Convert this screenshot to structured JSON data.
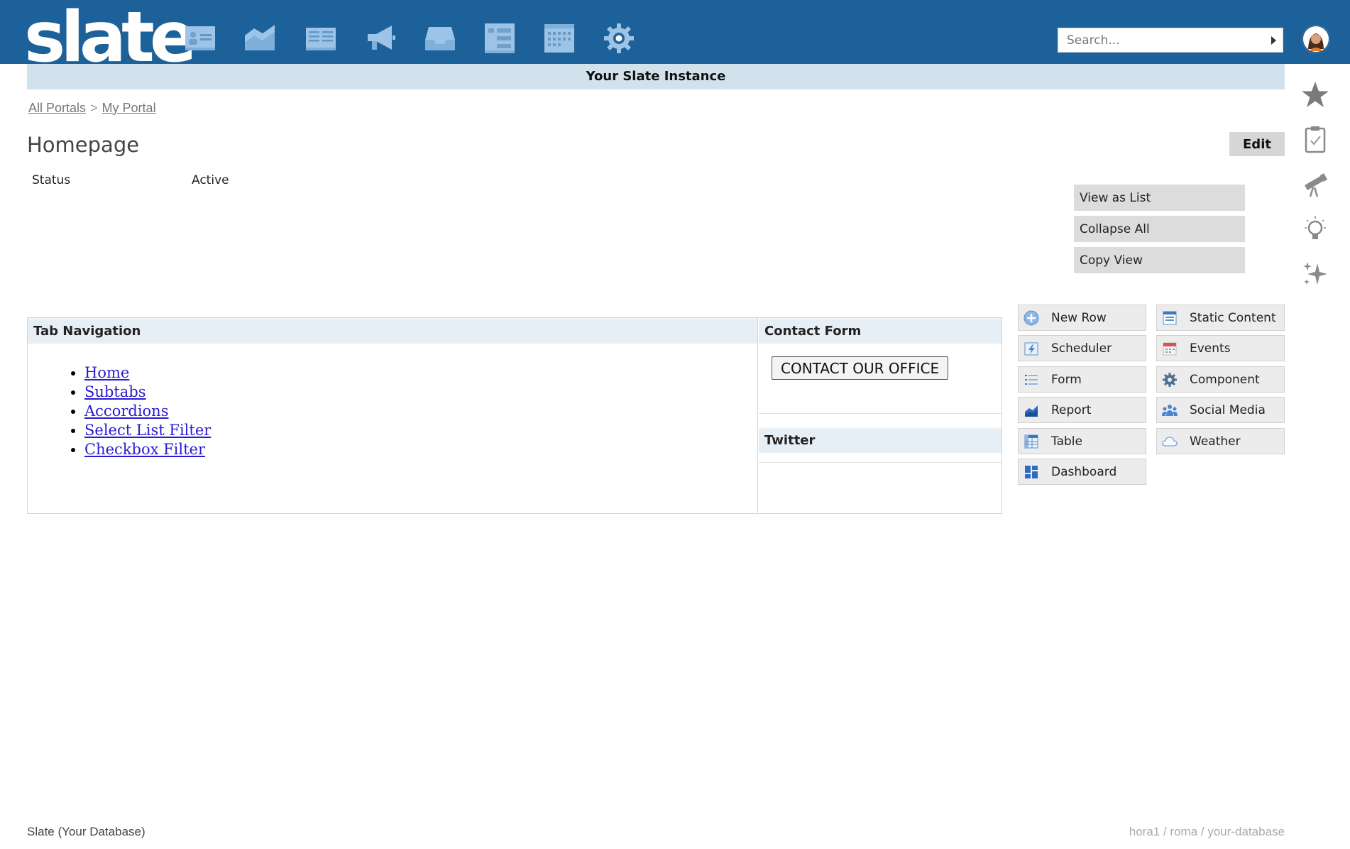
{
  "app": {
    "logo_text": "slate",
    "instance_banner": "Your Slate Instance",
    "brand_color": "#1c6199"
  },
  "nav_icons": [
    "contacts-card-icon",
    "reports-chart-icon",
    "book-icon",
    "megaphone-icon",
    "inbox-tray-icon",
    "list-icon",
    "calendar-icon",
    "gear-icon"
  ],
  "search": {
    "placeholder": "Search..."
  },
  "rail_icons": [
    "star-icon",
    "clipboard-check-icon",
    "telescope-icon",
    "lightbulb-icon",
    "sparkles-icon"
  ],
  "breadcrumb": {
    "items": [
      "All Portals",
      "My Portal"
    ],
    "separator": ">"
  },
  "page": {
    "title": "Homepage",
    "edit_label": "Edit",
    "status_label": "Status",
    "status_value": "Active"
  },
  "view_actions": [
    "View as List",
    "Collapse All",
    "Copy View"
  ],
  "canvas": {
    "tab_nav_title": "Tab Navigation",
    "tab_links": [
      "Home",
      "Subtabs",
      "Accordions",
      "Select List Filter",
      "Checkbox Filter"
    ],
    "contact_form_title": "Contact Form",
    "contact_button_label": "CONTACT OUR OFFICE",
    "twitter_title": "Twitter"
  },
  "widgets": [
    {
      "label": "New Row",
      "icon": "plus-circle-icon"
    },
    {
      "label": "Static Content",
      "icon": "static-content-icon"
    },
    {
      "label": "Scheduler",
      "icon": "scheduler-icon"
    },
    {
      "label": "Events",
      "icon": "events-calendar-icon"
    },
    {
      "label": "Form",
      "icon": "form-list-icon"
    },
    {
      "label": "Component",
      "icon": "component-gear-icon"
    },
    {
      "label": "Report",
      "icon": "report-chart-icon"
    },
    {
      "label": "Social Media",
      "icon": "social-media-icon"
    },
    {
      "label": "Table",
      "icon": "table-icon"
    },
    {
      "label": "Weather",
      "icon": "weather-cloud-icon"
    },
    {
      "label": "Dashboard",
      "icon": "dashboard-icon"
    }
  ],
  "footer": {
    "left": "Slate (Your Database)",
    "right": "hora1 / roma / your-database"
  }
}
